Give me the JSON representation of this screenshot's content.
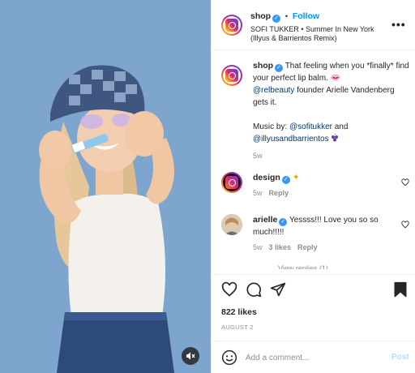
{
  "header": {
    "username": "shop",
    "separator": "•",
    "follow_label": "Follow",
    "audio": "SOFI TUKKER • Summer In New York",
    "audio_line2": "(Illyus & Barrientos Remix)",
    "more_icon": "more-horizontal-icon"
  },
  "caption": {
    "username": "shop",
    "text1": "That feeling when you *finally* find your perfect lip balm.",
    "emoji1": "lips-icon",
    "mention1": "@relbeauty",
    "text2": " founder Arielle Vandenberg gets it.",
    "music_prefix": "Music by: ",
    "mention2": "@sofitukker",
    "and": " and",
    "mention3": "@illyusandbarrientos",
    "emoji2": "grapes-icon",
    "time": "5w"
  },
  "comments": [
    {
      "username": "design",
      "text": "",
      "emoji": "sparkles-icon",
      "time": "5w",
      "likes": "",
      "reply": "Reply"
    },
    {
      "username": "arielle",
      "text": "Yessss!!! Love you so so much!!!!!",
      "time": "5w",
      "likes": "3 likes",
      "reply": "Reply"
    }
  ],
  "view_replies": "View replies (1)",
  "actions": {
    "likes": "822 likes",
    "date": "AUGUST 2"
  },
  "composer": {
    "placeholder": "Add a comment...",
    "post_label": "Post"
  },
  "colors": {
    "accent": "#0095f6",
    "verified": "#3897f0",
    "muted": "#8e8e8e",
    "post_disabled": "#b2dffc",
    "media_bg": "#7ea5cd"
  }
}
